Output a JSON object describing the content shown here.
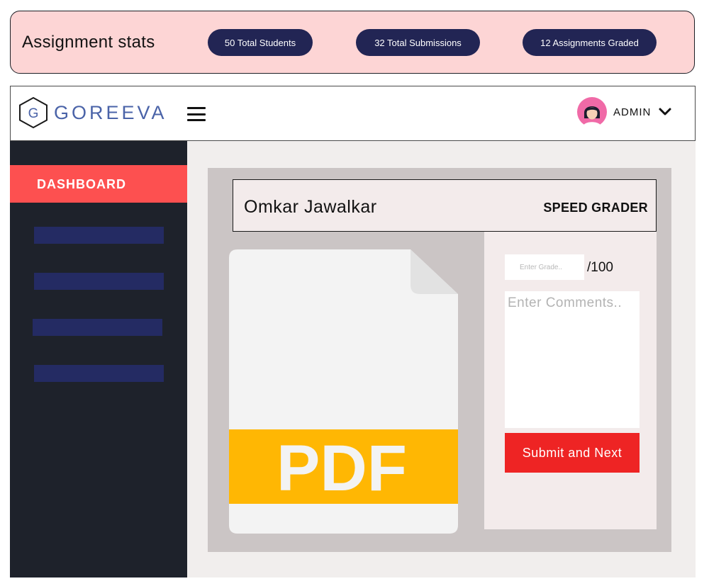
{
  "stats": {
    "title": "Assignment stats",
    "total_students": "50 Total Students",
    "total_submissions": "32 Total Submissions",
    "assignments_graded": "12 Assignments Graded"
  },
  "header": {
    "logo_letter": "G",
    "logo_text": "GOREEVA",
    "user_label": "ADMIN"
  },
  "sidebar": {
    "active_item": "DASHBOARD"
  },
  "grader": {
    "student_name": "Omkar Jawalkar",
    "mode_label": "SPEED GRADER",
    "document_label": "PDF",
    "grade_placeholder": "Enter Grade..",
    "grade_suffix": "/100",
    "comments_placeholder": "Enter Comments..",
    "submit_label": "Submit and Next"
  },
  "colors": {
    "stats_background": "#fdd5d5",
    "pill_background": "#222554",
    "logo_color": "#4a63a8",
    "sidebar_background": "#1e222b",
    "sidebar_active": "#fd5050",
    "sidebar_placeholder": "#242b63",
    "pdf_band": "#ffb703",
    "submit_button": "#ee2424"
  }
}
